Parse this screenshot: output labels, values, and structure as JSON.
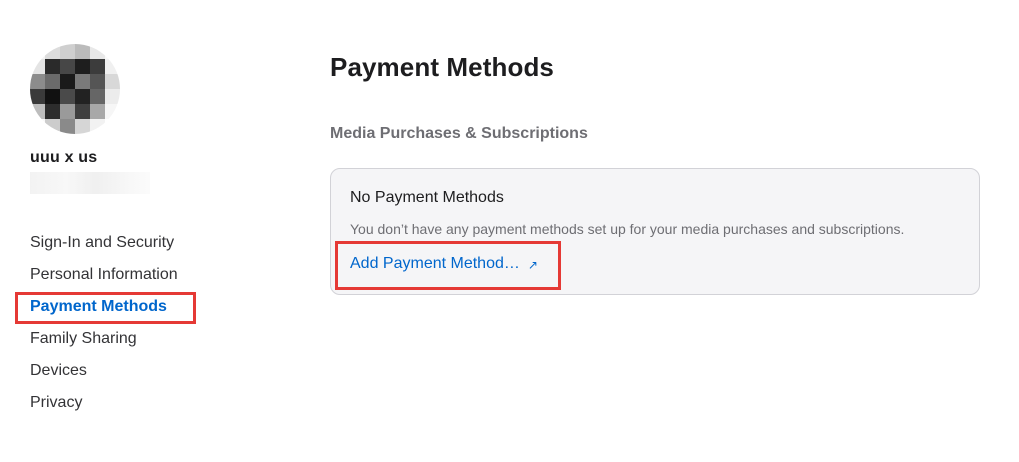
{
  "user": {
    "name": "uuu x us",
    "avatar_colors": [
      "#f4f4f4",
      "#dcdcdc",
      "#cfcfcf",
      "#bbbbbb",
      "#e8e8e8",
      "#fafafa",
      "#e4e4e4",
      "#2a2a2a",
      "#474747",
      "#1e1e1e",
      "#3c3c3c",
      "#f0f0f0",
      "#8c8c8c",
      "#6b6b6b",
      "#1a1a1a",
      "#7a7a7a",
      "#555555",
      "#d8d8d8",
      "#3a3a3a",
      "#111111",
      "#4a4a4a",
      "#222222",
      "#666666",
      "#ececec",
      "#bdbdbd",
      "#2c2c2c",
      "#9a9a9a",
      "#3f3f3f",
      "#a8a8a8",
      "#f6f6f6",
      "#f8f8f8",
      "#cccccc",
      "#8a8a8a",
      "#d6d6d6",
      "#f2f2f2",
      "#ffffff"
    ]
  },
  "sidebar": {
    "items": [
      {
        "label": "Sign-In and Security"
      },
      {
        "label": "Personal Information"
      },
      {
        "label": "Payment Methods",
        "active": true
      },
      {
        "label": "Family Sharing"
      },
      {
        "label": "Devices"
      },
      {
        "label": "Privacy"
      }
    ]
  },
  "main": {
    "title": "Payment Methods",
    "section_title": "Media Purchases & Subscriptions",
    "card": {
      "heading": "No Payment Methods",
      "description": "You don’t have any payment methods set up for your media purchases and subscriptions.",
      "link_label": "Add Payment Method…",
      "link_icon": "↗"
    }
  },
  "colors": {
    "accent": "#0066cc",
    "highlight": "#e53935"
  }
}
